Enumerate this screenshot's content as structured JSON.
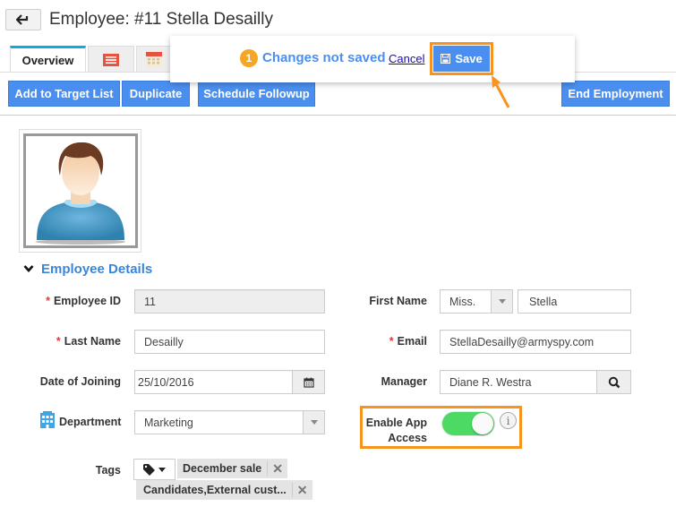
{
  "header": {
    "back_label": "back",
    "title": "Employee: #11 Stella Desailly"
  },
  "tabs": [
    {
      "label": "Overview",
      "active": true
    },
    {
      "icon": "list-icon",
      "active": false
    },
    {
      "icon": "calendar-icon",
      "active": false
    }
  ],
  "toolbar": {
    "add_to_target_list": "Add to Target List",
    "duplicate": "Duplicate",
    "schedule_followup": "Schedule Followup",
    "end_employment": "End Employment"
  },
  "unsaved_popover": {
    "count": "1",
    "message": "Changes not saved",
    "cancel_label": "Cancel",
    "save_label": "Save"
  },
  "section": {
    "title": "Employee Details",
    "expanded": true
  },
  "form": {
    "employee_id": {
      "label": "Employee ID",
      "required": true,
      "value": "11"
    },
    "last_name": {
      "label": "Last Name",
      "required": true,
      "value": "Desailly"
    },
    "date_of_joining": {
      "label": "Date of Joining",
      "value": "25/10/2016"
    },
    "department": {
      "label": "Department",
      "value": "Marketing"
    },
    "first_name": {
      "label": "First Name",
      "salutation": "Miss.",
      "value": "Stella"
    },
    "email": {
      "label": "Email",
      "required": true,
      "value": "StellaDesailly@armyspy.com"
    },
    "manager": {
      "label": "Manager",
      "value": "Diane R. Westra"
    },
    "app_access": {
      "label_line1": "Enable App",
      "label_line2": "Access",
      "enabled": true
    },
    "tags": {
      "label": "Tags",
      "items": [
        "December sale",
        "Candidates,External cust..."
      ]
    }
  },
  "colors": {
    "primary": "#4a8ff0",
    "highlight": "#f7931e",
    "toggle_on": "#4cd964",
    "required": "#e53935",
    "section_title": "#3a85d8"
  }
}
